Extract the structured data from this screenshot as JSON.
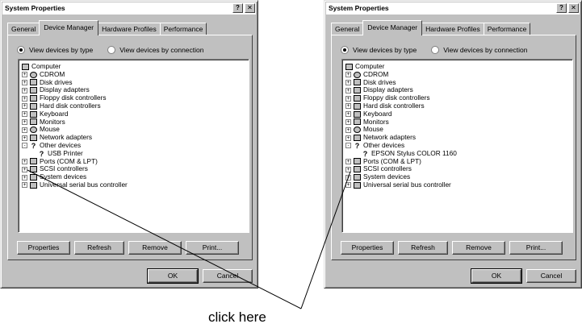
{
  "left_dialog": {
    "title": "System Properties",
    "tabs": [
      "General",
      "Device Manager",
      "Hardware Profiles",
      "Performance"
    ],
    "active_tab": "Device Manager",
    "radio_by_type": "View devices by type",
    "radio_by_connection": "View devices by connection",
    "tree": [
      {
        "label": "Computer",
        "icon": "computer-icon",
        "expander": "",
        "level": 0
      },
      {
        "label": "CDROM",
        "icon": "cdrom-icon",
        "expander": "+",
        "level": 1
      },
      {
        "label": "Disk drives",
        "icon": "disk-drive-icon",
        "expander": "+",
        "level": 1
      },
      {
        "label": "Display adapters",
        "icon": "display-adapter-icon",
        "expander": "+",
        "level": 1
      },
      {
        "label": "Floppy disk controllers",
        "icon": "floppy-controller-icon",
        "expander": "+",
        "level": 1
      },
      {
        "label": "Hard disk controllers",
        "icon": "hard-disk-controller-icon",
        "expander": "+",
        "level": 1
      },
      {
        "label": "Keyboard",
        "icon": "keyboard-icon",
        "expander": "+",
        "level": 1
      },
      {
        "label": "Monitors",
        "icon": "monitor-icon",
        "expander": "+",
        "level": 1
      },
      {
        "label": "Mouse",
        "icon": "mouse-icon",
        "expander": "+",
        "level": 1
      },
      {
        "label": "Network adapters",
        "icon": "network-adapter-icon",
        "expander": "+",
        "level": 1
      },
      {
        "label": "Other devices",
        "icon": "question-icon",
        "expander": "-",
        "level": 1
      },
      {
        "label": "USB Printer",
        "icon": "question-icon",
        "expander": "",
        "level": 2
      },
      {
        "label": "Ports (COM & LPT)",
        "icon": "port-icon",
        "expander": "+",
        "level": 1
      },
      {
        "label": "SCSI controllers",
        "icon": "scsi-icon",
        "expander": "+",
        "level": 1
      },
      {
        "label": "System devices",
        "icon": "system-device-icon",
        "expander": "+",
        "level": 1
      },
      {
        "label": "Universal serial bus controller",
        "icon": "usb-icon",
        "expander": "+",
        "level": 1
      }
    ],
    "buttons": [
      "Properties",
      "Refresh",
      "Remove",
      "Print..."
    ],
    "ok": "OK",
    "cancel": "Cancel"
  },
  "right_dialog": {
    "title": "System Properties",
    "tabs": [
      "General",
      "Device Manager",
      "Hardware Profiles",
      "Performance"
    ],
    "active_tab": "Device Manager",
    "radio_by_type": "View devices by type",
    "radio_by_connection": "View devices by connection",
    "tree": [
      {
        "label": "Computer",
        "icon": "computer-icon",
        "expander": "",
        "level": 0
      },
      {
        "label": "CDROM",
        "icon": "cdrom-icon",
        "expander": "+",
        "level": 1
      },
      {
        "label": "Disk drives",
        "icon": "disk-drive-icon",
        "expander": "+",
        "level": 1
      },
      {
        "label": "Display adapters",
        "icon": "display-adapter-icon",
        "expander": "+",
        "level": 1
      },
      {
        "label": "Floppy disk controllers",
        "icon": "floppy-controller-icon",
        "expander": "+",
        "level": 1
      },
      {
        "label": "Hard disk controllers",
        "icon": "hard-disk-controller-icon",
        "expander": "+",
        "level": 1
      },
      {
        "label": "Keyboard",
        "icon": "keyboard-icon",
        "expander": "+",
        "level": 1
      },
      {
        "label": "Monitors",
        "icon": "monitor-icon",
        "expander": "+",
        "level": 1
      },
      {
        "label": "Mouse",
        "icon": "mouse-icon",
        "expander": "+",
        "level": 1
      },
      {
        "label": "Network adapters",
        "icon": "network-adapter-icon",
        "expander": "+",
        "level": 1
      },
      {
        "label": "Other devices",
        "icon": "question-icon",
        "expander": "-",
        "level": 1
      },
      {
        "label": "EPSON Stylus COLOR 1160",
        "icon": "question-icon",
        "expander": "",
        "level": 2
      },
      {
        "label": "Ports (COM & LPT)",
        "icon": "port-icon",
        "expander": "+",
        "level": 1
      },
      {
        "label": "SCSI controllers",
        "icon": "scsi-icon",
        "expander": "+",
        "level": 1
      },
      {
        "label": "System devices",
        "icon": "system-device-icon",
        "expander": "+",
        "level": 1
      },
      {
        "label": "Universal serial bus controller",
        "icon": "usb-icon",
        "expander": "+",
        "level": 1
      }
    ],
    "buttons": [
      "Properties",
      "Refresh",
      "Remove",
      "Print..."
    ],
    "ok": "OK",
    "cancel": "Cancel"
  },
  "annotation": {
    "caption": "click here"
  }
}
